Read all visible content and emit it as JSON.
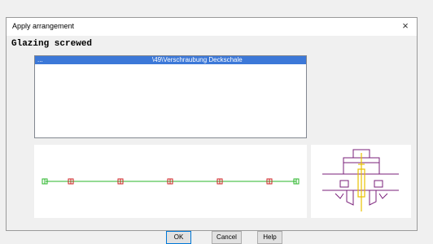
{
  "window": {
    "title": "Apply arrangement",
    "close_symbol": "×"
  },
  "heading": "Glazing screwed",
  "list": {
    "rows": [
      {
        "col1": "...",
        "col2": "\\49\\Verschraubung Deckschale"
      }
    ]
  },
  "buttons": {
    "ok": "OK",
    "cancel": "Cancel",
    "help": "Help"
  },
  "colors": {
    "selection": "#3c78d8",
    "line_green": "#2ab52a",
    "marker_red": "#cc2222",
    "drawing_purple": "#7a1f7a",
    "drawing_yellow": "#e8c000"
  }
}
